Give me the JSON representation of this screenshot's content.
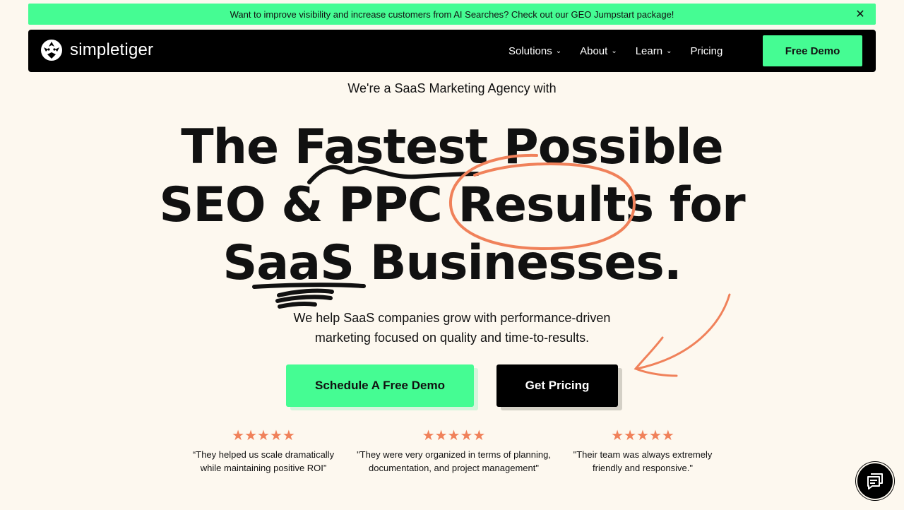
{
  "announcement": {
    "text": "Want to improve visibility and increase customers from AI Searches? Check out our GEO Jumpstart package!",
    "close_icon": "close-icon",
    "background": "#45fc93"
  },
  "nav": {
    "brand": "simpletiger",
    "logo_icon": "tiger-head-icon",
    "items": [
      {
        "label": "Solutions",
        "has_dropdown": true
      },
      {
        "label": "About",
        "has_dropdown": true
      },
      {
        "label": "Learn",
        "has_dropdown": true
      },
      {
        "label": "Pricing",
        "has_dropdown": false
      }
    ],
    "cta_label": "Free Demo"
  },
  "hero": {
    "eyebrow": "We're a SaaS Marketing Agency with",
    "headline": {
      "line1": "The Fastest Possible",
      "line2": "SEO & PPC Results for",
      "line3": "SaaS Businesses."
    },
    "subheading": "We help SaaS companies grow with performance-driven marketing focused on quality and time-to-results.",
    "primary_cta": "Schedule A Free Demo",
    "secondary_cta": "Get Pricing",
    "accent_color": "#f0815a"
  },
  "reviews": [
    {
      "stars": "★★★★★",
      "quote": "“They helped us scale dramatically while maintaining positive ROI”"
    },
    {
      "stars": "★★★★★",
      "quote": "\"They were very organized in terms of planning, documentation, and project management\""
    },
    {
      "stars": "★★★★★",
      "quote": "\"Their team was always extremely friendly and responsive.\""
    }
  ],
  "chat": {
    "icon": "chat-bubble-icon"
  }
}
